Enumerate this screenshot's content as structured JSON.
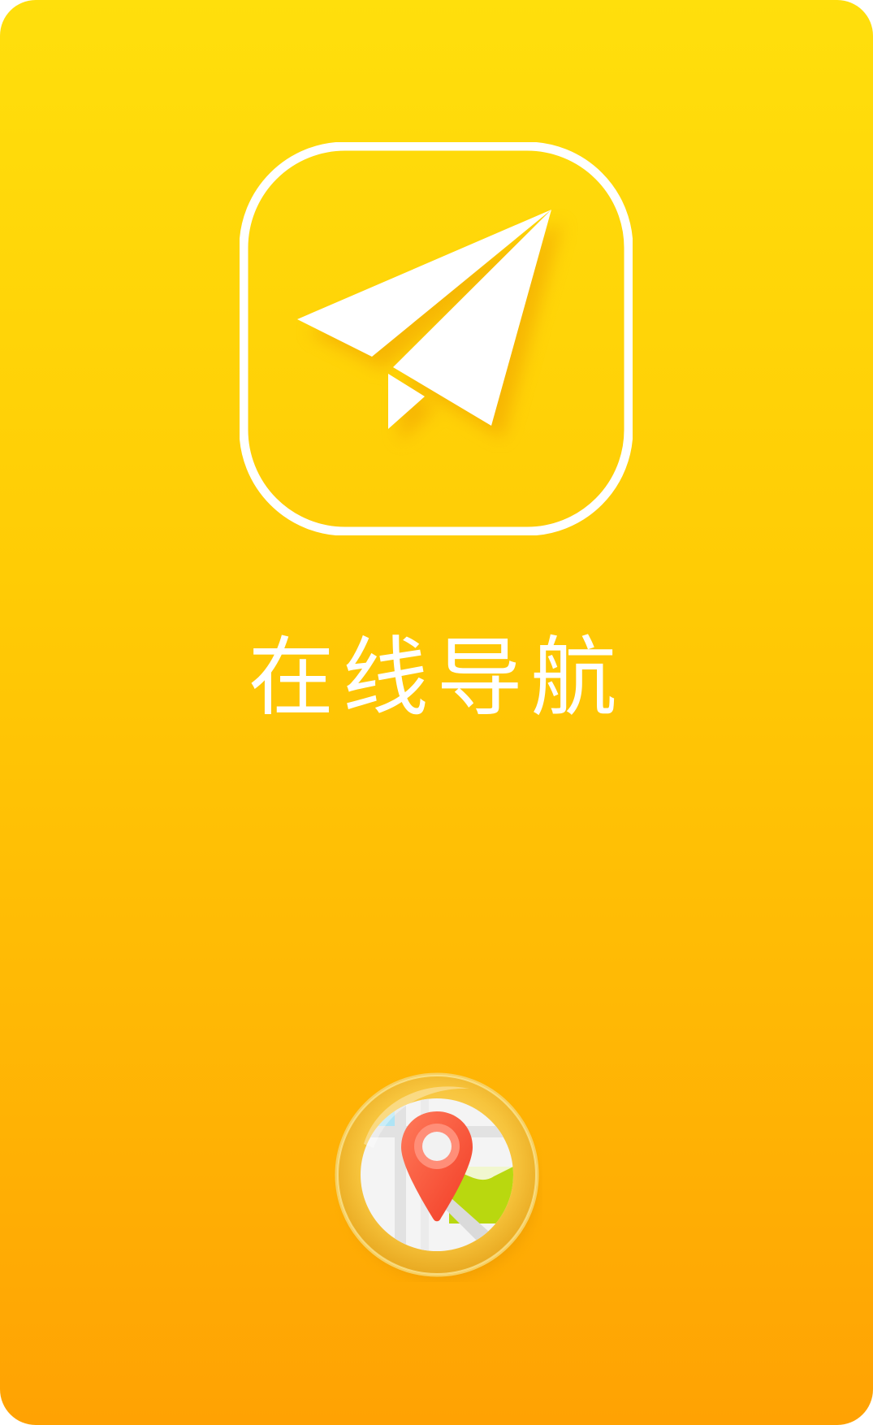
{
  "page": {
    "title": "在线导航",
    "background_gradient": [
      "#ffdf0c",
      "#ffa203"
    ]
  },
  "app_icon": {
    "icon": "paper-plane-icon",
    "frame_color": "#ffffff"
  },
  "map_button": {
    "icon": "map-location-pin-icon",
    "pin_color": "#ff5a3c"
  }
}
